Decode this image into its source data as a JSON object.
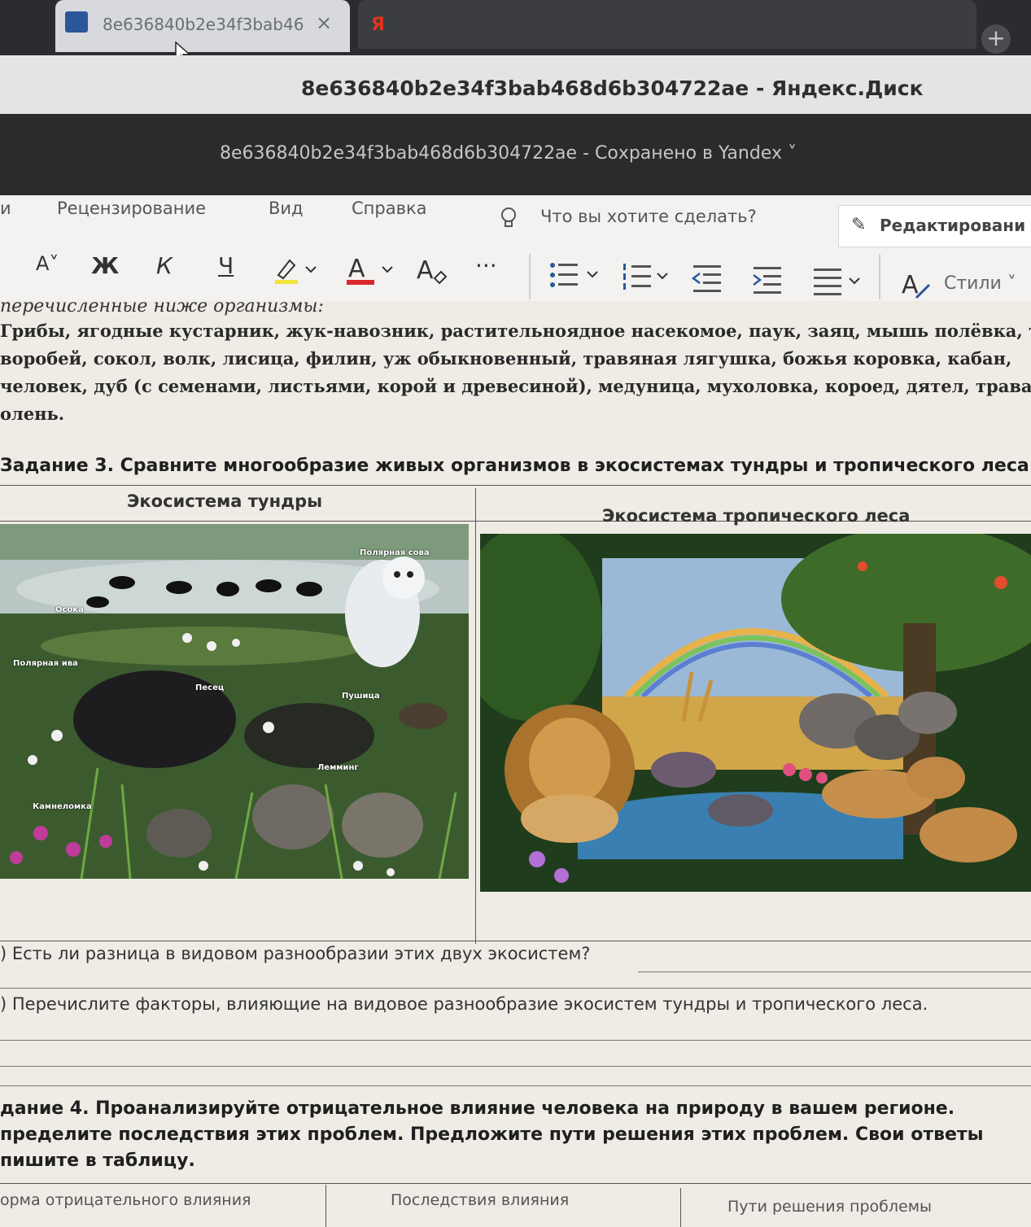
{
  "browser": {
    "tab_title": "8e636840b2e34f3bab46",
    "tab_close": "×",
    "tab2_favicon": "Я",
    "new_tab": "+",
    "window_title": "8e636840b2e34f3bab468d6b304722ae - Яндекс.Диск"
  },
  "word": {
    "doc_title": "8e636840b2e34f3bab468d6b304722ae  -  Сохранено в Yandex ˅",
    "menu": [
      "и",
      "Рецензирование",
      "Вид",
      "Справка"
    ],
    "tell_me": "Что вы хотите сделать?",
    "edit_button": "Редактировани",
    "toolbar": {
      "font_size_down": "A˅",
      "bold": "Ж",
      "italic": "К",
      "underline": "Ч",
      "more": "···",
      "styles": "Стили ˅"
    }
  },
  "document": {
    "intro_italic": "перечисленные ниже организмы:",
    "organisms_lines": [
      "Грибы, ягодные кустарник, жук-навозник, растительноядное насекомое, паук, заяц, мышь полёвка, т",
      "воробей, сокол, волк, лисица, филин, уж обыкновенный, травяная лягушка, божья коровка, кабан,",
      "человек, дуб (с семенами, листьями, корой и древесиной), медуница, мухоловка, короед, дятел, трава",
      "олень."
    ],
    "task3_title": "Задание 3. Сравните многообразие живых организмов в экосистемах тундры и тропического леса.",
    "col_tundra": "Экосистема тундры",
    "col_tropics": "Экосистема тропического леса",
    "tundra_labels": [
      "Полярная сова",
      "Осока",
      "Полярная ива",
      "Песец",
      "Пушица",
      "Лемминг",
      "Камнеломка"
    ],
    "question_a": ") Есть ли разница в видовом разнообразии этих двух экосистем?",
    "question_b": ") Перечислите факторы, влияющие на видовое разнообразие экосистем тундры и тропического леса.",
    "task4_lines": [
      "дание 4. Проанализируйте отрицательное влияние человека на природу в вашем регионе.",
      "пределите последствия этих проблем. Предложите пути решения этих проблем. Свои ответы",
      "пишите в таблицу."
    ],
    "task4_headers": [
      "орма отрицательного влияния",
      "Последствия влияния",
      "Пути решения проблемы"
    ]
  }
}
